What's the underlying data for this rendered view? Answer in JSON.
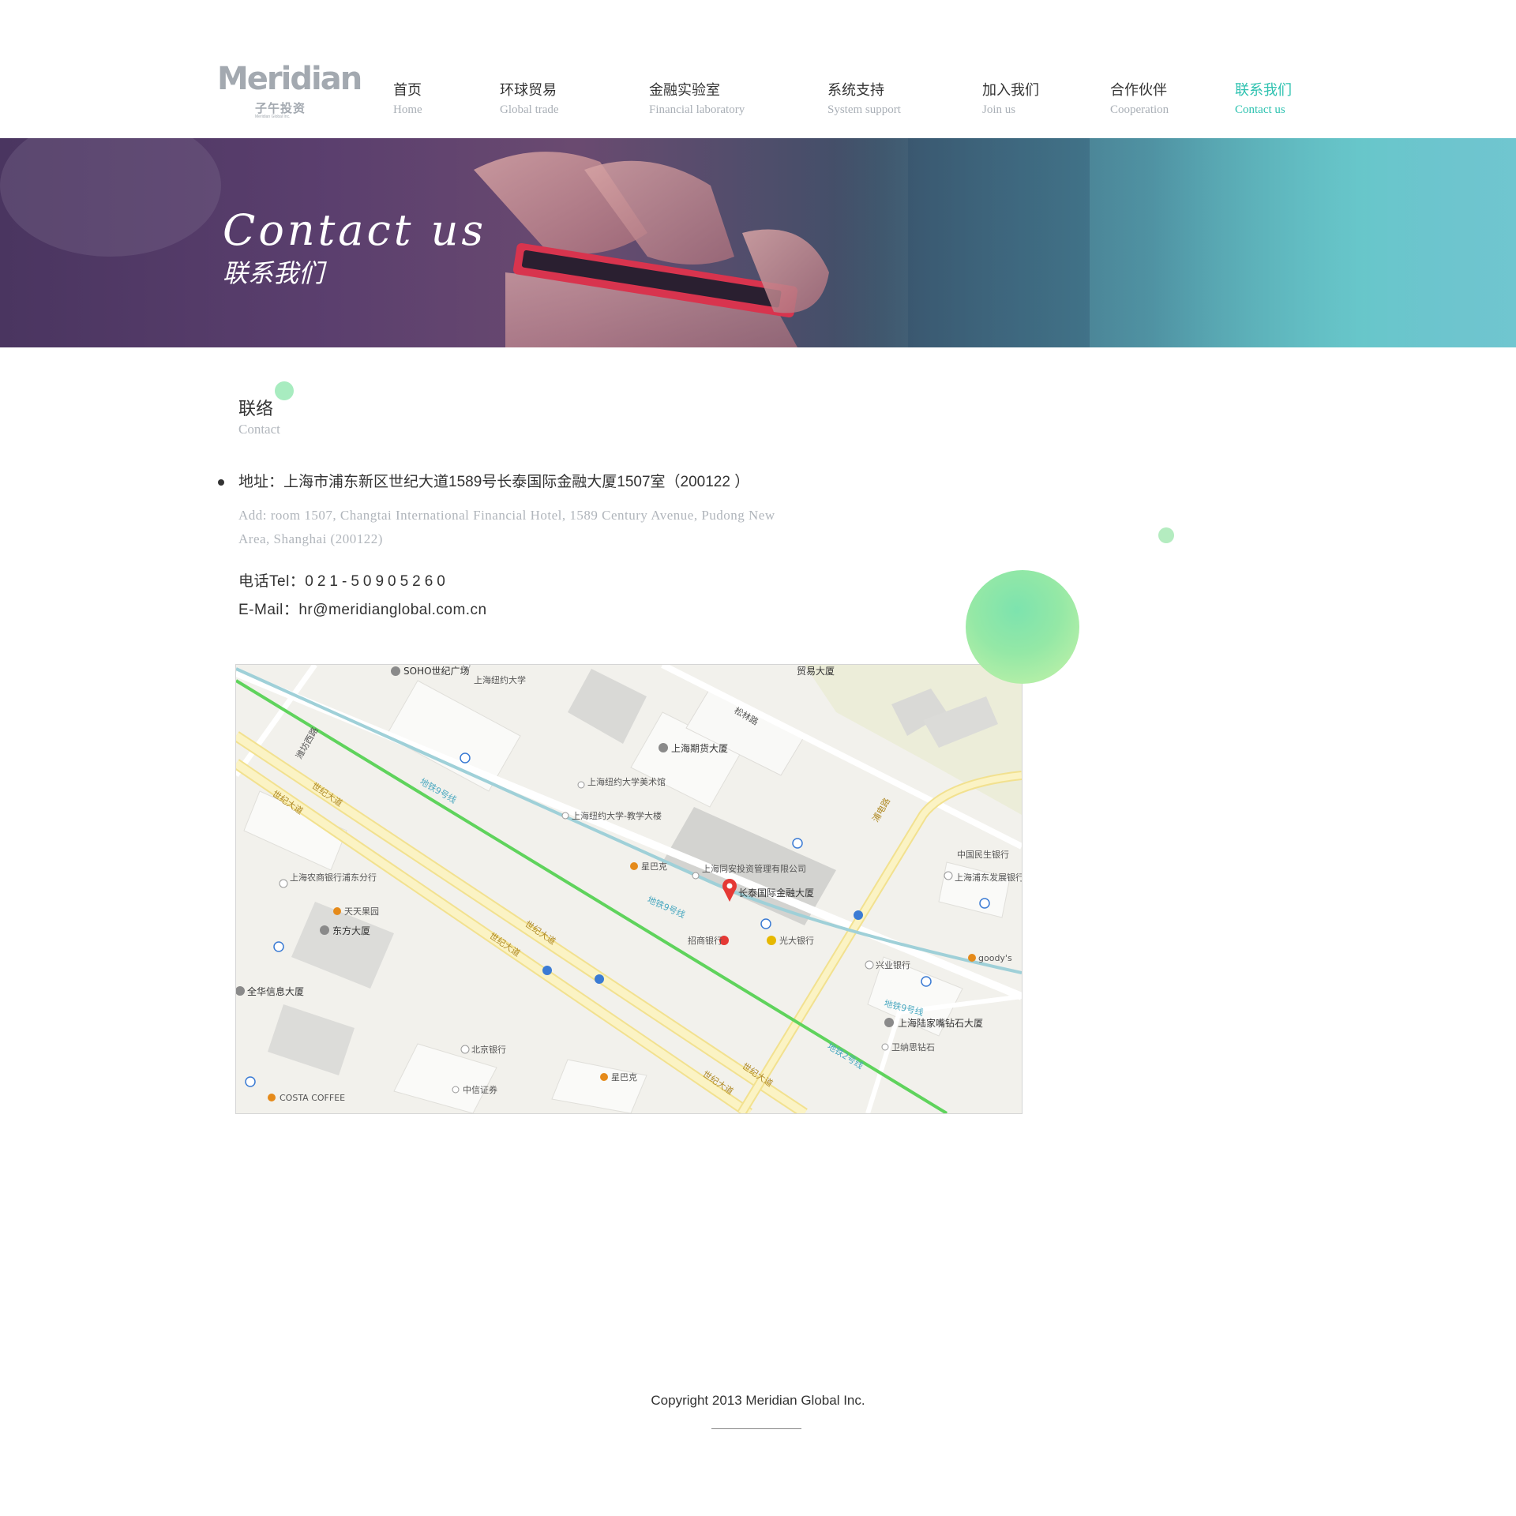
{
  "logo": {
    "word": "Meridian",
    "cn": "子午投资",
    "sub": "Meridian Global Inc."
  },
  "nav": [
    {
      "cn": "首页",
      "en": "Home"
    },
    {
      "cn": "环球贸易",
      "en": "Global trade"
    },
    {
      "cn": "金融实验室",
      "en": "Financial laboratory"
    },
    {
      "cn": "系统支持",
      "en": "System support"
    },
    {
      "cn": "加入我们",
      "en": "Join us"
    },
    {
      "cn": "合作伙伴",
      "en": "Cooperation"
    },
    {
      "cn": "联系我们",
      "en": "Contact us",
      "active": true
    }
  ],
  "banner": {
    "title_en": "Contact us",
    "title_cn": "联系我们"
  },
  "contact": {
    "title_cn": "联络",
    "title_en": "Contact",
    "address_cn": "地址：上海市浦东新区世纪大道1589号长泰国际金融大厦1507室（200122 ）",
    "address_en": "Add: room 1507, Changtai International Financial Hotel, 1589 Century Avenue, Pudong New Area, Shanghai (200122)",
    "tel_label": "电话Tel：",
    "tel_number": "021-50905260",
    "email_label": "E-Mail：",
    "email": "hr@meridianglobal.com.cn"
  },
  "map": {
    "labels": {
      "soho": "SOHO世纪广场",
      "niuyue": "上海纽约大学",
      "maoyi": "贸易大厦",
      "songlin": "松林路",
      "qihuo": "上海期货大厦",
      "meishuguan": "上海纽约大学美术馆",
      "jiaoxue": "上海纽约大学-教学大楼",
      "xingbake1": "星巴克",
      "tongan": "上海同安投资管理有限公司",
      "changtai": "长泰国际金融大厦",
      "zhaoshang": "招商银行",
      "guangda": "光大银行",
      "minsheng": "中国民生银行",
      "pufa": "上海浦东发展银行",
      "nongshang": "上海农商银行浦东分行",
      "tiantian": "天天果园",
      "dongfang": "东方大厦",
      "quanhua": "全华信息大厦",
      "beijing": "北京银行",
      "xingbake2": "星巴克",
      "zhongxin": "中信证券",
      "costa": "COSTA COFFEE",
      "xingye": "兴业银行",
      "goodys": "goody's",
      "lujiazui": "上海陆家嘴钻石大厦",
      "weina": "卫纳思钻石",
      "shiji": "世纪大道",
      "pudian": "浦电路",
      "weifang": "潍坊西路",
      "metro9": "地铁9号线",
      "metro2": "地铁2号线"
    }
  },
  "footer": {
    "copyright": "Copyright 2013   Meridian Global Inc."
  }
}
